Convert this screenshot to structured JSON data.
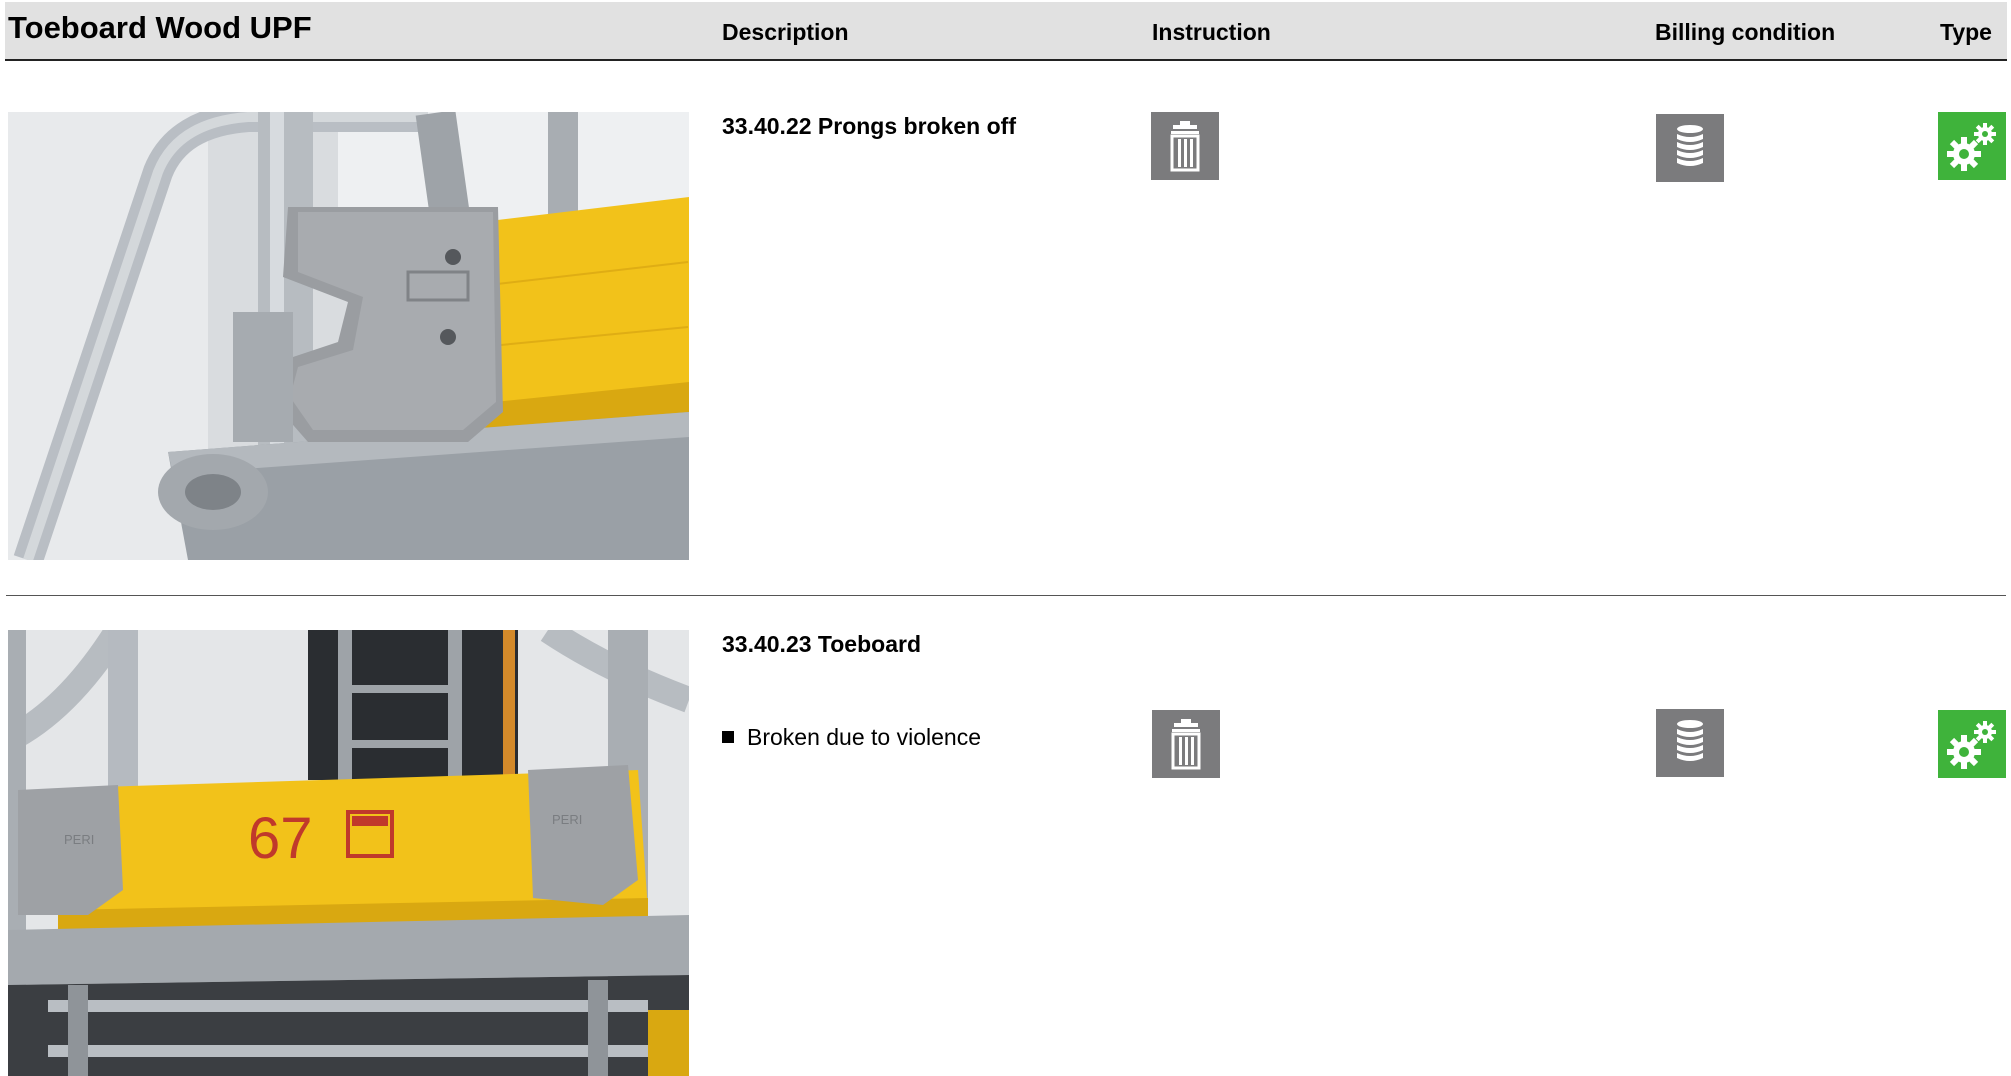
{
  "header": {
    "title": "Toeboard Wood UPF",
    "col_description": "Description",
    "col_instruction": "Instruction",
    "col_billing": "Billing condition",
    "col_type": "Type"
  },
  "rows": [
    {
      "code_label": "33.40.22 Prongs broken off",
      "photo_alt": "",
      "bullets": [],
      "instruction_icon": "trash-icon",
      "billing_icon": "coin-stack-icon",
      "type_icon": "gears-icon"
    },
    {
      "code_label": "33.40.23 Toeboard",
      "bullets": [
        "Broken due to violence"
      ],
      "board_number": "67",
      "clip_brand": "PERI",
      "instruction_icon": "trash-icon",
      "billing_icon": "coin-stack-icon",
      "type_icon": "gears-icon"
    }
  ],
  "colors": {
    "header_bg": "#e1e1e1",
    "icon_gray": "#7b7b7d",
    "icon_green": "#3fb33b",
    "board_yellow": "#f2c21a"
  }
}
